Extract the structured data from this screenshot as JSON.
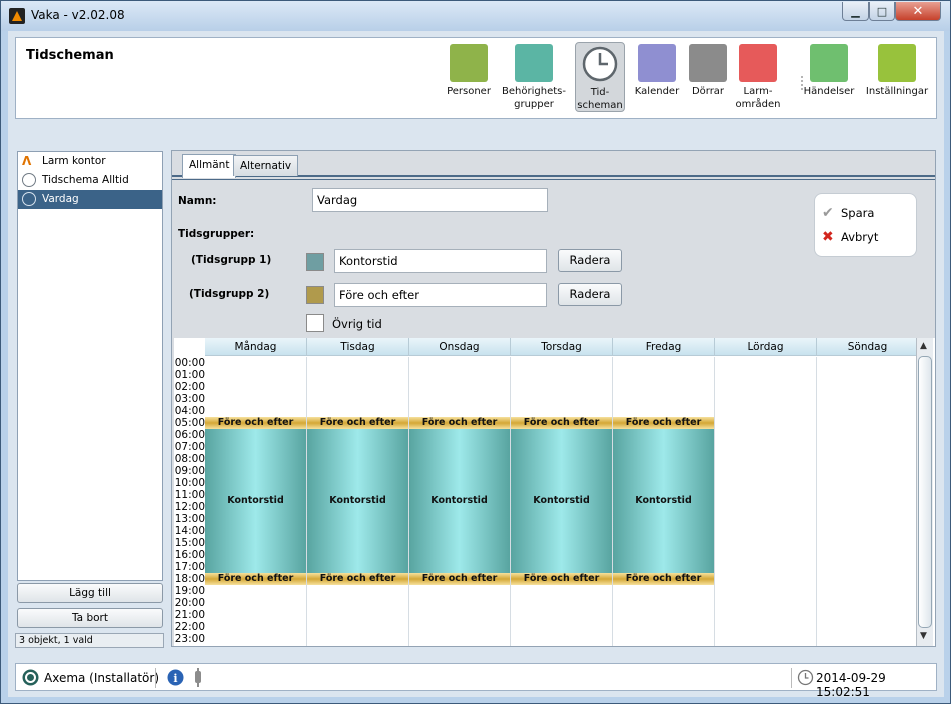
{
  "window": {
    "title": "Vaka - v2.02.08",
    "minimize": "▁",
    "maximize": "□",
    "close": "✕"
  },
  "header": {
    "title": "Tidscheman"
  },
  "toolbar": {
    "items": [
      {
        "label": "Personer",
        "icon": "persons-icon",
        "color": "#8fb34a"
      },
      {
        "label": "Behörighets-\ngrupper",
        "icon": "access-groups-icon",
        "color": "#5bb5a4"
      },
      {
        "label": "Tid-\nscheman",
        "icon": "clock-icon",
        "color": "#8b9296",
        "selected": true
      },
      {
        "label": "Kalender",
        "icon": "calendar-icon",
        "color": "#8f8fd1"
      },
      {
        "label": "Dörrar",
        "icon": "door-icon",
        "color": "#8b8b8b"
      },
      {
        "label": "Larm-\nområden",
        "icon": "alarm-areas-icon",
        "color": "#e65a5a"
      },
      {
        "label": "Händelser",
        "icon": "events-icon",
        "color": "#6fbf6f"
      },
      {
        "label": "Inställningar",
        "icon": "settings-icon",
        "color": "#98c23c"
      }
    ]
  },
  "sidebar": {
    "items": [
      {
        "label": "Larm kontor",
        "icon": "alarm-icon"
      },
      {
        "label": "Tidschema Alltid",
        "icon": "clock-icon"
      },
      {
        "label": "Vardag",
        "icon": "clock-icon",
        "selected": true
      }
    ],
    "add_label": "Lägg till",
    "remove_label": "Ta bort",
    "status": "3 objekt, 1 vald"
  },
  "tabs": [
    {
      "label": "Allmänt",
      "selected": true
    },
    {
      "label": "Alternativ"
    }
  ],
  "form": {
    "name_label": "Namn:",
    "name_value": "Vardag",
    "timegroups_label": "Tidsgrupper:",
    "groups": [
      {
        "label": "(Tidsgrupp 1)",
        "value": "Kontorstid",
        "color": "#6f9ea2",
        "delete_label": "Radera"
      },
      {
        "label": "(Tidsgrupp 2)",
        "value": "Före och efter",
        "color": "#b09a4c",
        "delete_label": "Radera"
      }
    ],
    "other_label": "Övrig tid",
    "other_color": "#ffffff"
  },
  "actions": {
    "save_label": "Spara",
    "cancel_label": "Avbryt"
  },
  "schedule": {
    "days": [
      "Måndag",
      "Tisdag",
      "Onsdag",
      "Torsdag",
      "Fredag",
      "Lördag",
      "Söndag"
    ],
    "hours": [
      "00:00",
      "01:00",
      "02:00",
      "03:00",
      "04:00",
      "05:00",
      "06:00",
      "07:00",
      "08:00",
      "09:00",
      "10:00",
      "11:00",
      "12:00",
      "13:00",
      "14:00",
      "15:00",
      "16:00",
      "17:00",
      "18:00",
      "19:00",
      "20:00",
      "21:00",
      "22:00",
      "23:00"
    ],
    "blocks": [
      {
        "day": 0,
        "start": 5,
        "end": 6,
        "label": "Före och efter",
        "type": "fe"
      },
      {
        "day": 0,
        "start": 6,
        "end": 18,
        "label": "Kontorstid",
        "type": "ko"
      },
      {
        "day": 0,
        "start": 18,
        "end": 19,
        "label": "Före och efter",
        "type": "fe"
      },
      {
        "day": 1,
        "start": 5,
        "end": 6,
        "label": "Före och efter",
        "type": "fe"
      },
      {
        "day": 1,
        "start": 6,
        "end": 18,
        "label": "Kontorstid",
        "type": "ko"
      },
      {
        "day": 1,
        "start": 18,
        "end": 19,
        "label": "Före och efter",
        "type": "fe"
      },
      {
        "day": 2,
        "start": 5,
        "end": 6,
        "label": "Före och efter",
        "type": "fe"
      },
      {
        "day": 2,
        "start": 6,
        "end": 18,
        "label": "Kontorstid",
        "type": "ko"
      },
      {
        "day": 2,
        "start": 18,
        "end": 19,
        "label": "Före och efter",
        "type": "fe"
      },
      {
        "day": 3,
        "start": 5,
        "end": 6,
        "label": "Före och efter",
        "type": "fe"
      },
      {
        "day": 3,
        "start": 6,
        "end": 18,
        "label": "Kontorstid",
        "type": "ko"
      },
      {
        "day": 3,
        "start": 18,
        "end": 19,
        "label": "Före och efter",
        "type": "fe"
      },
      {
        "day": 4,
        "start": 5,
        "end": 6,
        "label": "Före och efter",
        "type": "fe"
      },
      {
        "day": 4,
        "start": 6,
        "end": 18,
        "label": "Kontorstid",
        "type": "ko"
      },
      {
        "day": 4,
        "start": 18,
        "end": 19,
        "label": "Före och efter",
        "type": "fe"
      }
    ]
  },
  "statusbar": {
    "user": "Axema (Installatör)",
    "datetime": "2014-09-29 15:02:51"
  }
}
